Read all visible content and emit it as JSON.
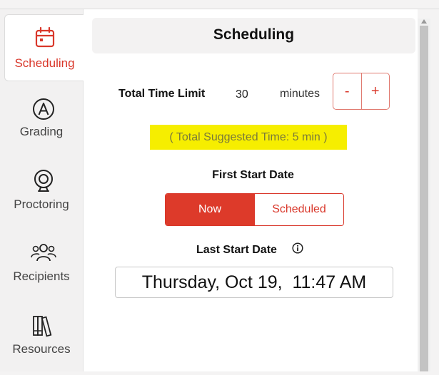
{
  "sidebar": {
    "items": [
      {
        "label": "Scheduling",
        "icon": "calendar-icon",
        "active": true
      },
      {
        "label": "Grading",
        "icon": "grading-a-icon",
        "active": false
      },
      {
        "label": "Proctoring",
        "icon": "webcam-icon",
        "active": false
      },
      {
        "label": "Recipients",
        "icon": "people-icon",
        "active": false
      },
      {
        "label": "Resources",
        "icon": "books-icon",
        "active": false
      }
    ],
    "active_color": "#d9372a"
  },
  "main": {
    "title": "Scheduling",
    "time_limit": {
      "label": "Total Time Limit",
      "value": "30",
      "unit": "minutes",
      "decrement_label": "-",
      "increment_label": "+"
    },
    "suggested_time": "( Total Suggested Time: 5 min )",
    "first_start": {
      "label": "First Start Date",
      "options": [
        "Now",
        "Scheduled"
      ],
      "selected": "Now"
    },
    "last_start": {
      "label": "Last Start Date",
      "value": "Thursday, Oct 19,  11:47 AM"
    }
  },
  "colors": {
    "accent": "#dd3a2a",
    "highlight": "#f6ee00"
  }
}
